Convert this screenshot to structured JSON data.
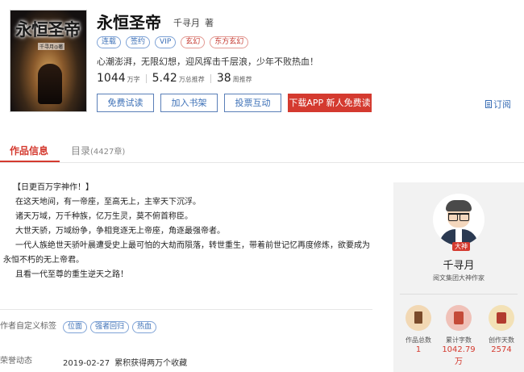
{
  "book": {
    "cover_title": "永恒圣帝",
    "cover_author": "千寻月◎著",
    "title": "永恒圣帝",
    "author": "千寻月",
    "author_suffix": "著",
    "tags": [
      "连载",
      "签约",
      "VIP",
      "玄幻",
      "东方玄幻"
    ],
    "intro": "心潮澎湃，无限幻想，迎风挥击千层浪，少年不败热血！",
    "stats": [
      {
        "value": "1044",
        "unit": "万字"
      },
      {
        "value": "5.42",
        "unit": "万总推荐"
      },
      {
        "value": "38",
        "unit": "周推荐"
      }
    ]
  },
  "buttons": {
    "read": "免费试读",
    "shelf": "加入书架",
    "vote": "投票互动",
    "app": "下载APP  新人免费读",
    "subscribe": "订阅"
  },
  "tabs": {
    "info": "作品信息",
    "catalog": "目录",
    "catalog_count": "(4427章)"
  },
  "description": [
    "【日更百万字神作！】",
    "在这天地间，有一帝座，至高无上，主宰天下沉浮。",
    "诸天万域，万千种族，亿万生灵，莫不俯首称臣。",
    "大世天骄，万域纷争，争相竞逐无上帝座，角逐最强帝者。",
    "一代人族绝世天骄叶晨遭受史上最可怕的大劫而陨落，转世重生，带着前世记忆再度修炼，欲要成为永恒不朽的无上帝君。",
    "且看一代至尊的重生逆天之路！"
  ],
  "custom_tags": {
    "label": "作者自定义标签",
    "items": [
      "位面",
      "强者回归",
      "热血"
    ]
  },
  "honor": {
    "label": "荣誉动态",
    "date": "2019-02-27",
    "text": "累积获得两万个收藏"
  },
  "author_card": {
    "badge": "大神",
    "name": "千寻月",
    "title": "阅文集团大神作家",
    "stats": [
      {
        "label": "作品总数",
        "value": "1",
        "icon": "book-icon"
      },
      {
        "label": "累计字数",
        "value": "1042.79万",
        "icon": "calculator-icon"
      },
      {
        "label": "创作天数",
        "value": "2574",
        "icon": "calendar-icon"
      }
    ]
  },
  "colors": {
    "accent_red": "#d43a2f",
    "link_blue": "#3b6fb6",
    "side_bg": "#f2f2f2"
  }
}
